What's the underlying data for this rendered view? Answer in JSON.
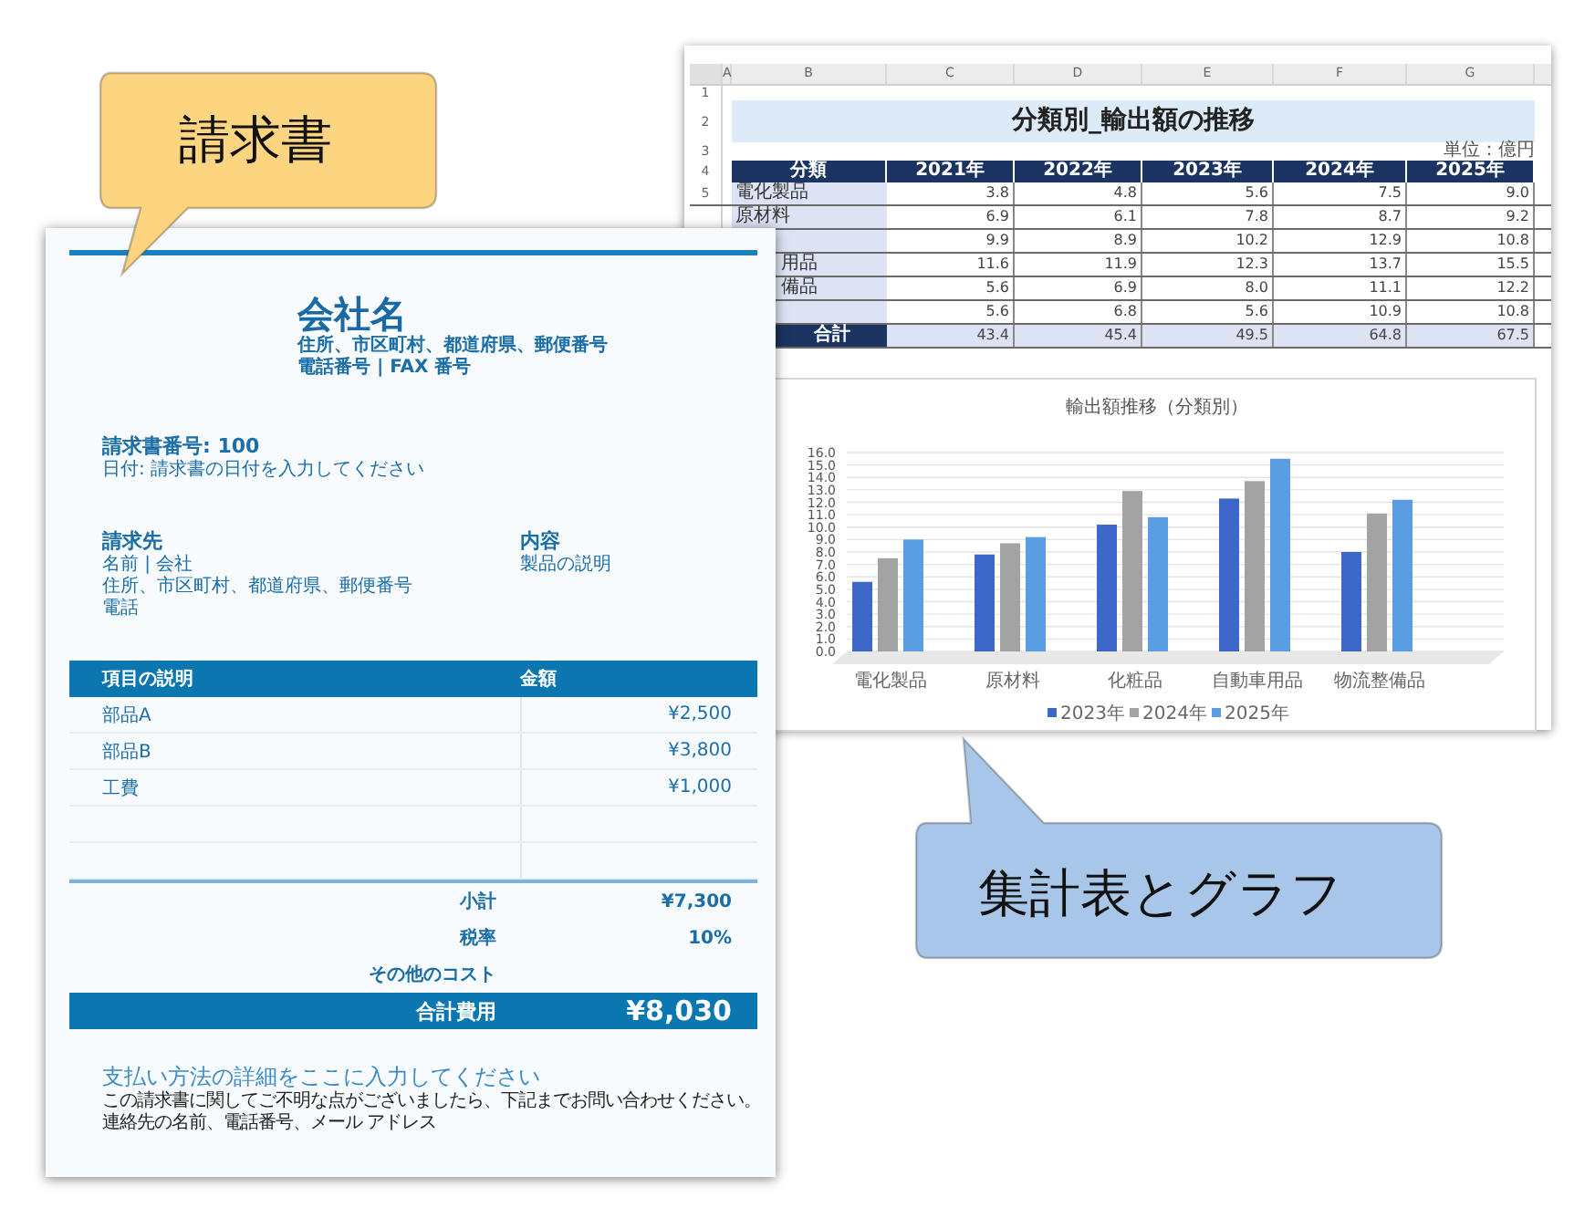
{
  "spreadsheet": {
    "column_headers": [
      "A",
      "B",
      "C",
      "D",
      "E",
      "F",
      "G"
    ],
    "row_numbers": [
      "1",
      "2",
      "3",
      "4",
      "5"
    ],
    "title": "分類別_輸出額の推移",
    "unit": "単位：億円",
    "table": {
      "columns": [
        "分類",
        "2021年",
        "2022年",
        "2023年",
        "2024年",
        "2025年"
      ],
      "rows": [
        {
          "category": "電化製品",
          "values": [
            "3.8",
            "4.8",
            "5.6",
            "7.5",
            "9.0"
          ]
        },
        {
          "category": "原材料",
          "values": [
            "6.9",
            "6.1",
            "7.8",
            "8.7",
            "9.2"
          ]
        },
        {
          "values": [
            "9.9",
            "8.9",
            "10.2",
            "12.9",
            "10.8"
          ]
        },
        {
          "category": "用品",
          "clipped": true,
          "values": [
            "11.6",
            "11.9",
            "12.3",
            "13.7",
            "15.5"
          ]
        },
        {
          "category": "備品",
          "clipped": true,
          "values": [
            "5.6",
            "6.9",
            "8.0",
            "11.1",
            "12.2"
          ]
        },
        {
          "values": [
            "5.6",
            "6.8",
            "5.6",
            "10.9",
            "10.8"
          ]
        }
      ],
      "total": {
        "label": "合計",
        "values": [
          "43.4",
          "45.4",
          "49.5",
          "64.8",
          "67.5"
        ]
      }
    },
    "chart": {
      "chart_data": {
        "type": "bar",
        "title": "輸出額推移（分類別）",
        "grid": true,
        "legend": true,
        "categories": [
          "電化製品",
          "原材料",
          "化粧品",
          "自動車用品",
          "物流整備品"
        ],
        "series": [
          {
            "name": "2023年",
            "color": "#3d67c9",
            "values": [
              5.6,
              7.8,
              10.2,
              12.3,
              8.0
            ]
          },
          {
            "name": "2024年",
            "color": "#a3a3a3",
            "values": [
              7.5,
              8.7,
              12.9,
              13.7,
              11.1
            ]
          },
          {
            "name": "2025年",
            "color": "#5b9de2",
            "values": [
              9.0,
              9.2,
              10.8,
              15.5,
              12.2
            ]
          }
        ],
        "ylim": [
          0,
          16
        ],
        "yticks": [
          {
            "value": 0,
            "label": "0.0"
          },
          {
            "value": 1,
            "label": "1.0"
          },
          {
            "value": 2,
            "label": "2.0"
          },
          {
            "value": 3,
            "label": "3.0"
          },
          {
            "value": 4,
            "label": "4.0"
          },
          {
            "value": 5,
            "label": "5.0"
          },
          {
            "value": 6,
            "label": "6.0"
          },
          {
            "value": 7,
            "label": "7.0"
          },
          {
            "value": 8,
            "label": "8.0"
          },
          {
            "value": 9,
            "label": "9.0"
          },
          {
            "value": 10,
            "label": "10.0"
          },
          {
            "value": 11,
            "label": "11.0"
          },
          {
            "value": 12,
            "label": "12.0"
          },
          {
            "value": 13,
            "label": "13.0"
          },
          {
            "value": 14,
            "label": "14.0"
          },
          {
            "value": 15,
            "label": "15.0"
          },
          {
            "value": 16,
            "label": "16.0"
          }
        ]
      }
    }
  },
  "invoice": {
    "company": "会社名",
    "address": "住所、市区町村、都道府県、郵便番号",
    "phone_fax": "電話番号 | FAX 番号",
    "invoice_number": "請求書番号: 100",
    "date": "日付: 請求書の日付を入力してください",
    "bill_to": {
      "heading": "請求先",
      "lines": [
        "名前 | 会社",
        "住所、市区町村、都道府県、郵便番号",
        "電話"
      ]
    },
    "content": {
      "heading": "内容",
      "text": "製品の説明"
    },
    "columns": [
      "項目の説明",
      "金額"
    ],
    "items": [
      {
        "description": "部品A",
        "amount": "¥2,500"
      },
      {
        "description": "部品B",
        "amount": "¥3,800"
      },
      {
        "description": "工費",
        "amount": "¥1,000"
      }
    ],
    "summary": [
      {
        "label": "小計",
        "value": "¥7,300"
      },
      {
        "label": "税率",
        "value": "10%"
      },
      {
        "label": "その他のコスト"
      }
    ],
    "total": {
      "label": "合計費用",
      "value": "¥8,030"
    },
    "payment": "支払い方法の詳細をここに入力してください",
    "notes": [
      "この請求書に関してご不明な点がございましたら、下記までお問い合わせください。",
      "連絡先の名前、電話番号、メール アドレス"
    ]
  },
  "callouts": [
    {
      "text": "請求書",
      "color": "#fdd580",
      "kind": "tail-down"
    },
    {
      "text": "集計表とグラフ",
      "color": "#a8c6e8",
      "kind": "tail-up"
    }
  ]
}
